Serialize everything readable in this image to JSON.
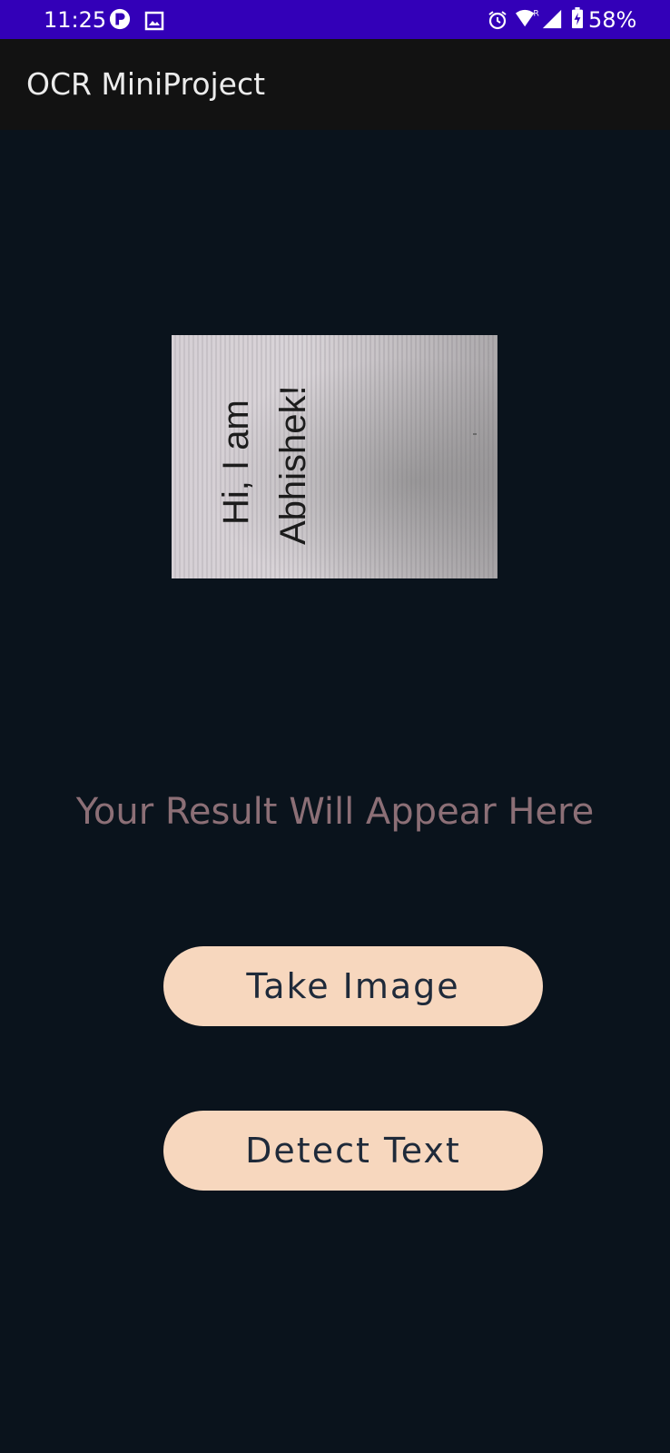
{
  "status_bar": {
    "time": "11:25",
    "battery_percent": "58%",
    "icons": [
      "app-notification-icon",
      "image-icon",
      "alarm-icon",
      "wifi-icon",
      "signal-icon",
      "battery-charging-icon"
    ],
    "roaming_label": "R",
    "background_color": "#3300b8"
  },
  "app_bar": {
    "title": "OCR MiniProject",
    "background_color": "#121212"
  },
  "preview_image": {
    "text_line_1": "Hi, I am",
    "text_line_2": "Abhishek!"
  },
  "result": {
    "placeholder_text": "Your Result Will Appear Here",
    "color": "#8c6f76"
  },
  "buttons": {
    "take_image_label": "Take Image",
    "detect_text_label": "Detect Text",
    "background_color": "#f7d7be",
    "text_color": "#1f2a3a"
  },
  "theme": {
    "background": "#0a131c"
  }
}
